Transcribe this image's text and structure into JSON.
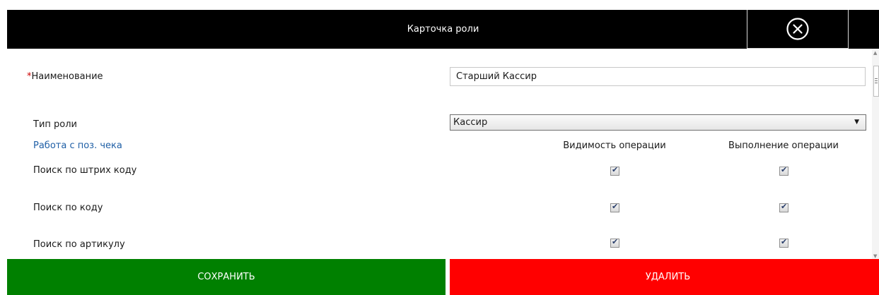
{
  "window": {
    "title": "Карточка роли",
    "close_icon": "circle-x-icon"
  },
  "form": {
    "name_required_mark": "*",
    "name_label": "Наименование",
    "name_value": "Старший Кассир",
    "role_type_label": "Тип роли",
    "role_type_value": "Кассир"
  },
  "permissions": {
    "section_title": "Работа с поз. чека",
    "col_visibility": "Видимость операции",
    "col_execution": "Выполнение операции",
    "rows": [
      {
        "label": "Поиск по штрих коду",
        "visible": true,
        "execute": true
      },
      {
        "label": "Поиск по коду",
        "visible": true,
        "execute": true
      },
      {
        "label": "Поиск по артикулу",
        "visible": true,
        "execute": true
      }
    ]
  },
  "actions": {
    "save_label": "СОХРАНИТЬ",
    "delete_label": "УДАЛИТЬ"
  },
  "colors": {
    "save": "#008000",
    "delete": "#ff0000",
    "titlebar": "#000000",
    "section_link": "#1f5fa6"
  }
}
